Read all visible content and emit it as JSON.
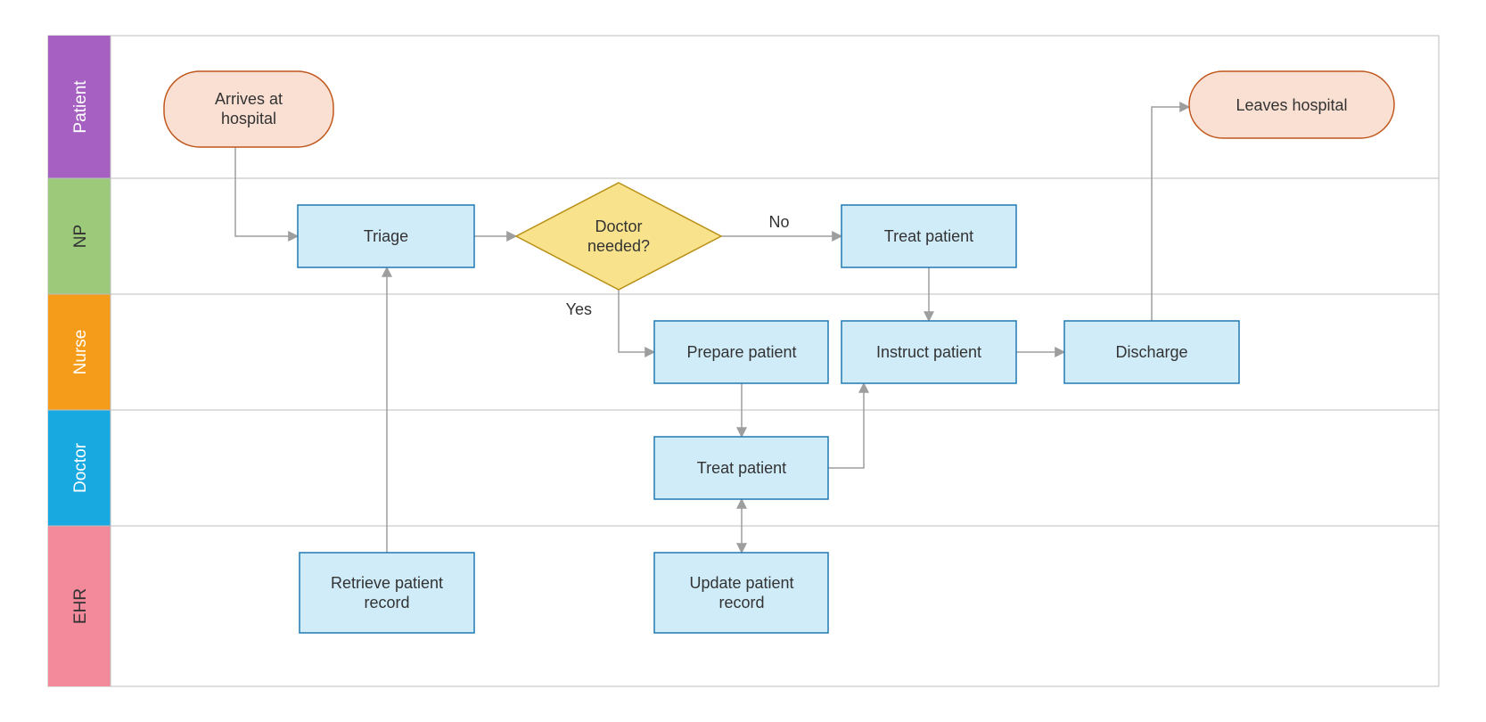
{
  "diagram": {
    "lanes": [
      {
        "id": "patient",
        "label": "Patient"
      },
      {
        "id": "np",
        "label": "NP"
      },
      {
        "id": "nurse",
        "label": "Nurse"
      },
      {
        "id": "doctor",
        "label": "Doctor"
      },
      {
        "id": "ehr",
        "label": "EHR"
      }
    ],
    "nodes": {
      "arrives": "Arrives at hospital",
      "leaves": "Leaves hospital",
      "triage": "Triage",
      "decision": "Doctor needed?",
      "treat_np": "Treat patient",
      "prepare": "Prepare patient",
      "instruct": "Instruct patient",
      "discharge": "Discharge",
      "treat_doc": "Treat patient",
      "retrieve": "Retrieve patient record",
      "update": "Update patient record"
    },
    "edgeLabels": {
      "yes": "Yes",
      "no": "No"
    }
  },
  "chart_data": {
    "type": "swimlane-flowchart",
    "lanes": [
      "Patient",
      "NP",
      "Nurse",
      "Doctor",
      "EHR"
    ],
    "nodes": [
      {
        "id": "arrives",
        "lane": "Patient",
        "type": "terminator",
        "label": "Arrives at hospital"
      },
      {
        "id": "leaves",
        "lane": "Patient",
        "type": "terminator",
        "label": "Leaves hospital"
      },
      {
        "id": "triage",
        "lane": "NP",
        "type": "process",
        "label": "Triage"
      },
      {
        "id": "decision",
        "lane": "NP",
        "type": "decision",
        "label": "Doctor needed?"
      },
      {
        "id": "treat_np",
        "lane": "NP",
        "type": "process",
        "label": "Treat patient"
      },
      {
        "id": "prepare",
        "lane": "Nurse",
        "type": "process",
        "label": "Prepare patient"
      },
      {
        "id": "instruct",
        "lane": "Nurse",
        "type": "process",
        "label": "Instruct patient"
      },
      {
        "id": "discharge",
        "lane": "Nurse",
        "type": "process",
        "label": "Discharge"
      },
      {
        "id": "treat_doc",
        "lane": "Doctor",
        "type": "process",
        "label": "Treat patient"
      },
      {
        "id": "retrieve",
        "lane": "EHR",
        "type": "process",
        "label": "Retrieve patient record"
      },
      {
        "id": "update",
        "lane": "EHR",
        "type": "process",
        "label": "Update patient record"
      }
    ],
    "edges": [
      {
        "from": "arrives",
        "to": "triage"
      },
      {
        "from": "triage",
        "to": "decision"
      },
      {
        "from": "decision",
        "to": "treat_np",
        "label": "No"
      },
      {
        "from": "decision",
        "to": "prepare",
        "label": "Yes"
      },
      {
        "from": "prepare",
        "to": "treat_doc"
      },
      {
        "from": "treat_doc",
        "to": "update",
        "bidirectional": true
      },
      {
        "from": "treat_doc",
        "to": "instruct"
      },
      {
        "from": "treat_np",
        "to": "instruct"
      },
      {
        "from": "instruct",
        "to": "discharge"
      },
      {
        "from": "discharge",
        "to": "leaves"
      },
      {
        "from": "retrieve",
        "to": "triage"
      }
    ]
  }
}
